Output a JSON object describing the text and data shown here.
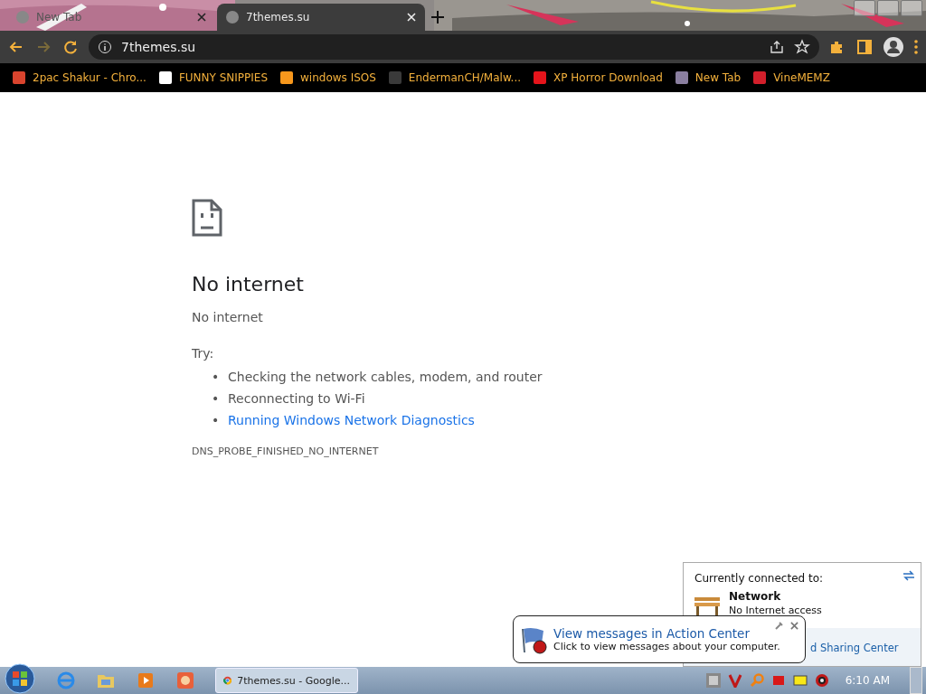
{
  "tabs": [
    {
      "title": "New Tab",
      "selected": false
    },
    {
      "title": "7themes.su",
      "selected": true
    }
  ],
  "address_bar": {
    "url": "7themes.su"
  },
  "bookmarks": [
    {
      "label": "2pac Shakur - Chro...",
      "color": "#d9442e"
    },
    {
      "label": "FUNNY SNIPPIES",
      "color": "#ffffff"
    },
    {
      "label": "windows ISOS",
      "color": "#f7971c"
    },
    {
      "label": "EndermanCH/Malw...",
      "color": "#3a3a3a"
    },
    {
      "label": "XP Horror Download",
      "color": "#e5141b"
    },
    {
      "label": "New Tab",
      "color": "#8a7fa0"
    },
    {
      "label": "VineMEMZ",
      "color": "#d21f2b"
    }
  ],
  "error_page": {
    "heading": "No internet",
    "message": "No internet",
    "try_label": "Try:",
    "suggestions": [
      {
        "bullet": "•",
        "text": "Checking the network cables, modem, and router",
        "kind": "text"
      },
      {
        "bullet": "•",
        "text": "Reconnecting to Wi-Fi",
        "kind": "text"
      },
      {
        "bullet": "•",
        "text": "Running Windows Network Diagnostics",
        "kind": "link"
      }
    ],
    "error_code": "DNS_PROBE_FINISHED_NO_INTERNET"
  },
  "network_popup": {
    "heading": "Currently connected to:",
    "network_name": "Network",
    "network_status": "No Internet access",
    "link": "d Sharing Center"
  },
  "notification": {
    "title": "View messages in Action Center",
    "body": "Click to view messages about your computer."
  },
  "taskbar": {
    "window_button": "7themes.su - Google...",
    "clock": "6:10 AM"
  }
}
